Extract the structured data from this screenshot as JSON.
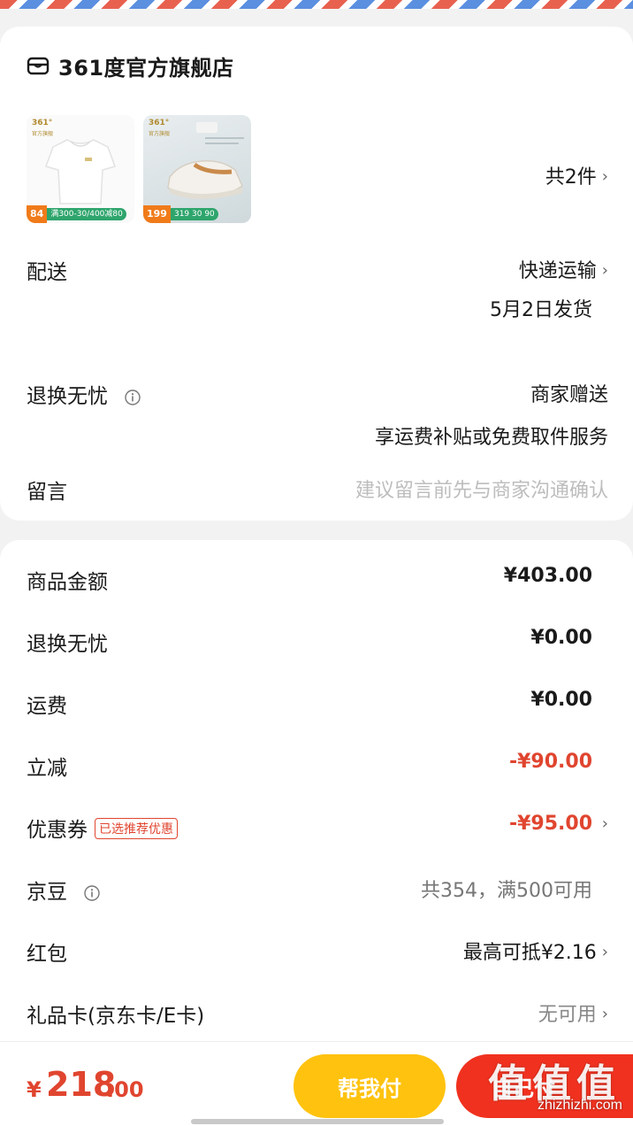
{
  "shop": {
    "name": "361度官方旗舰店",
    "icon": "store-icon"
  },
  "products": [
    {
      "brand": "361°",
      "brand_sub": "官方旗舰",
      "price": "84",
      "promo": "满300-30/400减80"
    },
    {
      "brand": "361°",
      "brand_sub": "官方旗舰",
      "price": "199",
      "promo": "319  30  90"
    }
  ],
  "items_count": "共2件",
  "delivery": {
    "label": "配送",
    "method": "快递运输",
    "ship_date": "5月2日发货"
  },
  "returns": {
    "label": "退换无忧",
    "value": "商家赠送",
    "desc": "享运费补贴或免费取件服务"
  },
  "message": {
    "label": "留言",
    "placeholder": "建议留言前先与商家沟通确认"
  },
  "summary": {
    "goods_label": "商品金额",
    "goods_value": "¥403.00",
    "returns_label": "退换无忧",
    "returns_value": "¥0.00",
    "shipping_label": "运费",
    "shipping_value": "¥0.00",
    "discount_label": "立减",
    "discount_value": "-¥90.00",
    "coupon_label": "优惠券",
    "coupon_tag": "已选推荐优惠",
    "coupon_value": "-¥95.00",
    "jingdou_label": "京豆",
    "jingdou_value": "共354，满500可用",
    "redpacket_label": "红包",
    "redpacket_value": "最高可抵¥2.16",
    "giftcard_label": "礼品卡(京东卡/E卡)",
    "giftcard_value": "无可用"
  },
  "bottom": {
    "currency": "¥",
    "total_int": "218",
    "total_dec": ".00",
    "help_pay": "帮我付",
    "pay_partial": "自己付"
  },
  "watermark": {
    "chars": [
      "值",
      "值",
      "值"
    ],
    "site": "zhizhizhi.com"
  },
  "colors": {
    "accent_red": "#e0452f",
    "help_yellow": "#ffc20e",
    "pay_red": "#f0311f"
  }
}
